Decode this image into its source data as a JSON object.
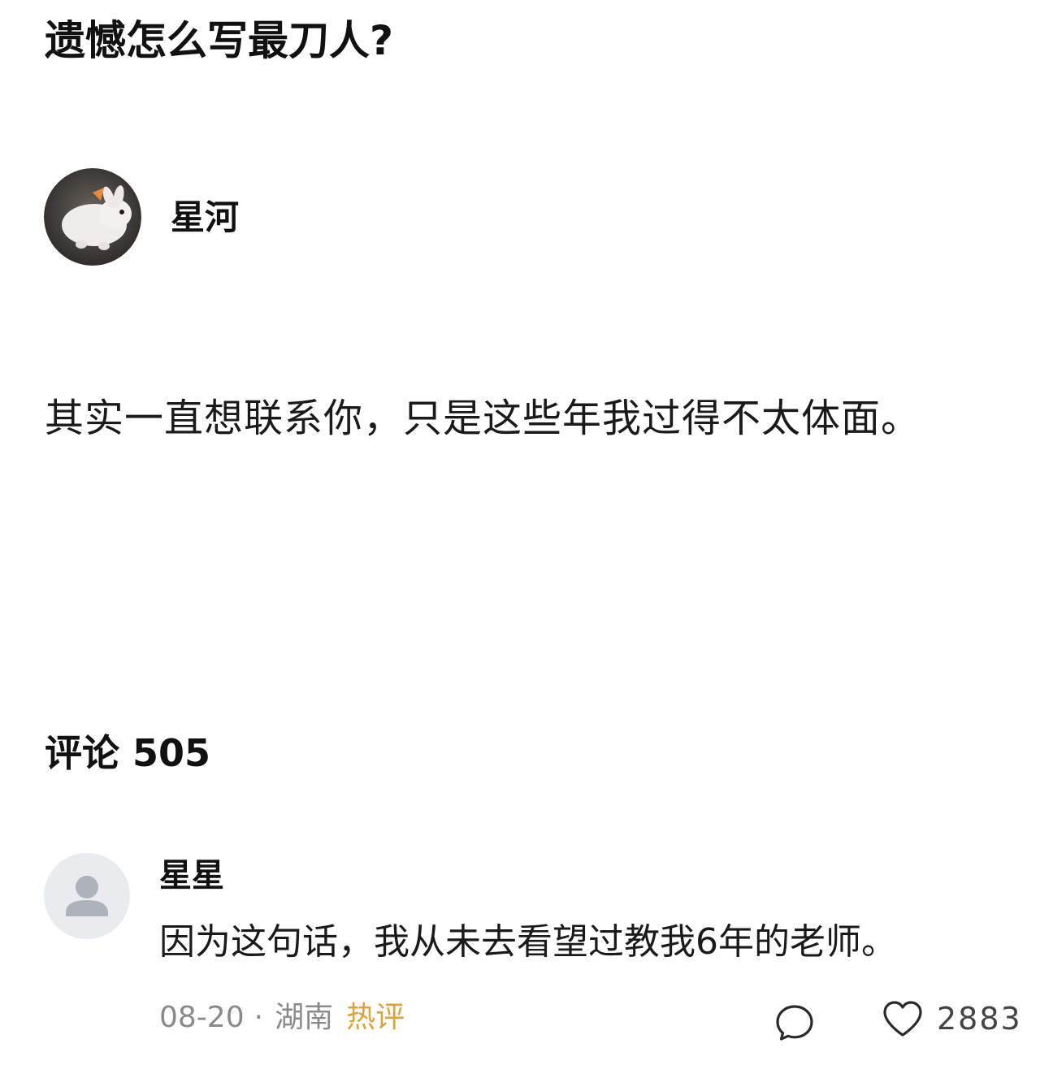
{
  "question": {
    "title": "遗憾怎么写最刀人?"
  },
  "answer": {
    "author": {
      "name": "星河",
      "avatar_icon": "rabbit-avatar"
    },
    "text": "其实一直想联系你，只是这些年我过得不太体面。"
  },
  "comments": {
    "label": "评论",
    "count": "505",
    "items": [
      {
        "author": "星星",
        "avatar_icon": "default-user-avatar",
        "text": "因为这句话，我从未去看望过教我6年的老师。",
        "date": "08-20",
        "separator": "·",
        "location": "湖南",
        "badge": "热评",
        "like_count": "2883",
        "reply_icon": "comment-bubble-icon",
        "like_icon": "heart-outline-icon"
      }
    ]
  },
  "colors": {
    "badge": "#d9a440",
    "meta_text": "#8a8a8a",
    "default_avatar_bg": "#e9ebee",
    "default_avatar_fg": "#aeb3ba"
  }
}
